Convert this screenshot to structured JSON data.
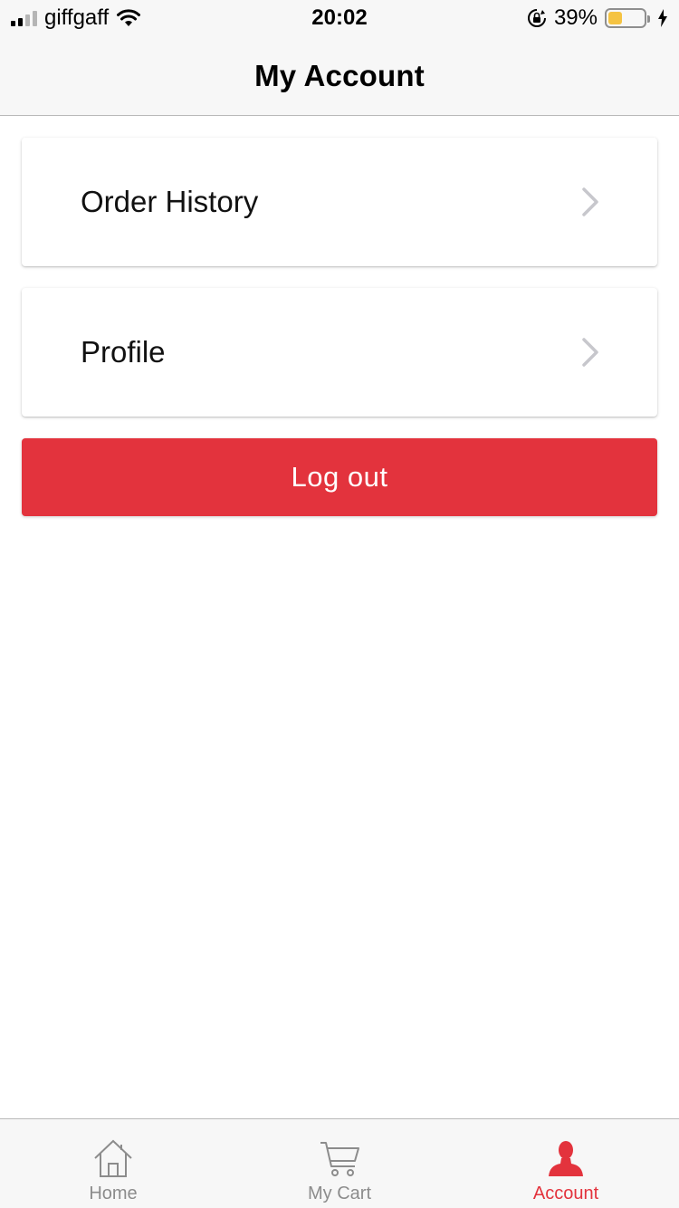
{
  "status_bar": {
    "carrier": "giffgaff",
    "time": "20:02",
    "battery_percent": "39%",
    "battery_level": 0.39,
    "signal_bars_active": 2,
    "icons": [
      "signal-icon",
      "wifi-icon",
      "orientation-lock-icon",
      "battery-icon",
      "charging-icon"
    ]
  },
  "header": {
    "title": "My Account"
  },
  "menu": {
    "items": [
      {
        "label": "Order History",
        "icon": "chevron-right-icon"
      },
      {
        "label": "Profile",
        "icon": "chevron-right-icon"
      }
    ]
  },
  "logout": {
    "label": "Log out"
  },
  "tabs": [
    {
      "label": "Home",
      "icon": "home-icon",
      "active": false
    },
    {
      "label": "My Cart",
      "icon": "cart-icon",
      "active": false
    },
    {
      "label": "Account",
      "icon": "user-icon",
      "active": true
    }
  ],
  "colors": {
    "accent": "#e3333d",
    "battery_fill": "#f5c342",
    "inactive": "#8c8c8c"
  }
}
